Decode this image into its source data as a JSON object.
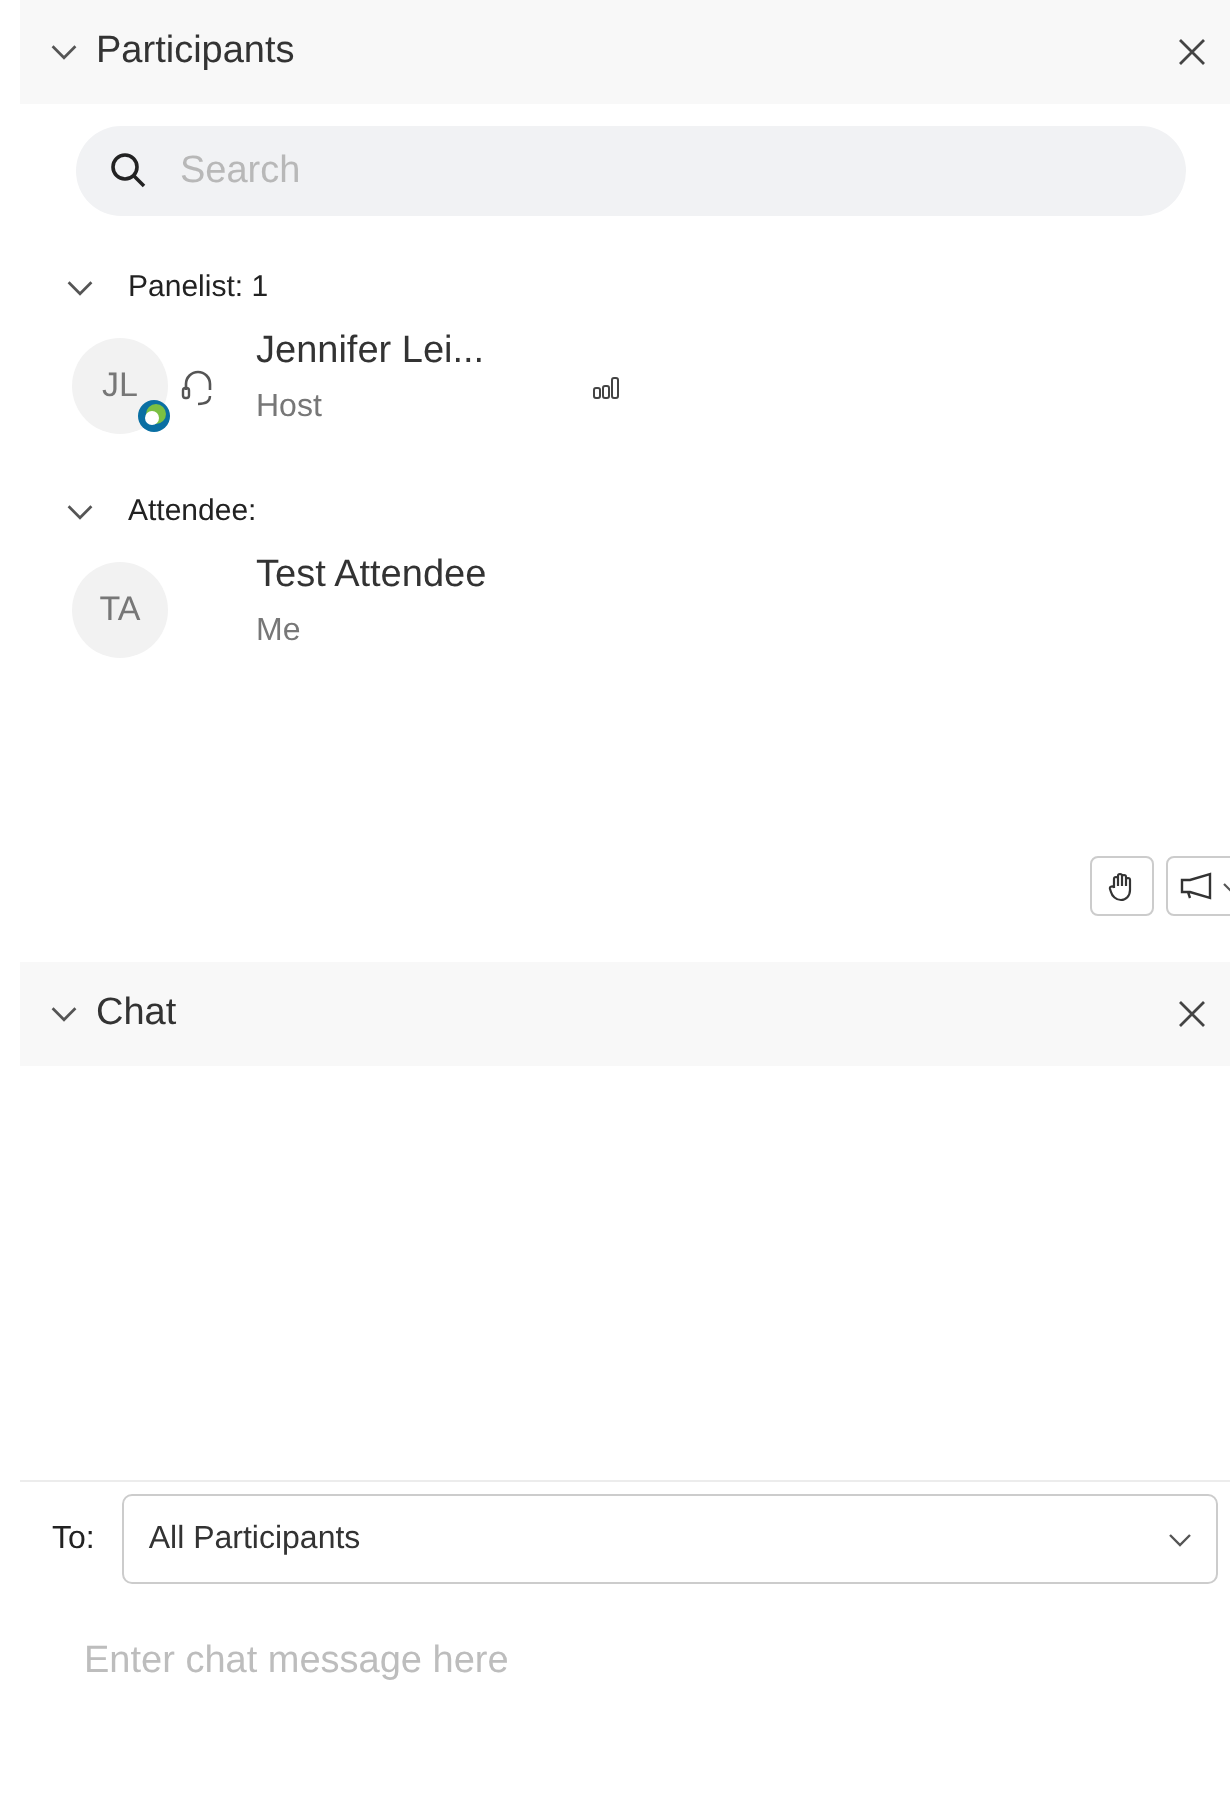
{
  "participants": {
    "title": "Participants",
    "expanded": true,
    "search": {
      "placeholder": "Search"
    },
    "groups": [
      {
        "label": "Panelist: 1",
        "expanded": true,
        "members": [
          {
            "initials": "JL",
            "name": "Jennifer Lei...",
            "role": "Host",
            "kind": "host"
          }
        ]
      },
      {
        "label": "Attendee:",
        "expanded": true,
        "members": [
          {
            "initials": "TA",
            "name": "Test Attendee",
            "role": "Me",
            "kind": "self"
          }
        ]
      }
    ]
  },
  "chat": {
    "title": "Chat",
    "expanded": true,
    "to_label": "To:",
    "recipient": "All Participants",
    "message": {
      "placeholder": "Enter chat message here"
    }
  }
}
